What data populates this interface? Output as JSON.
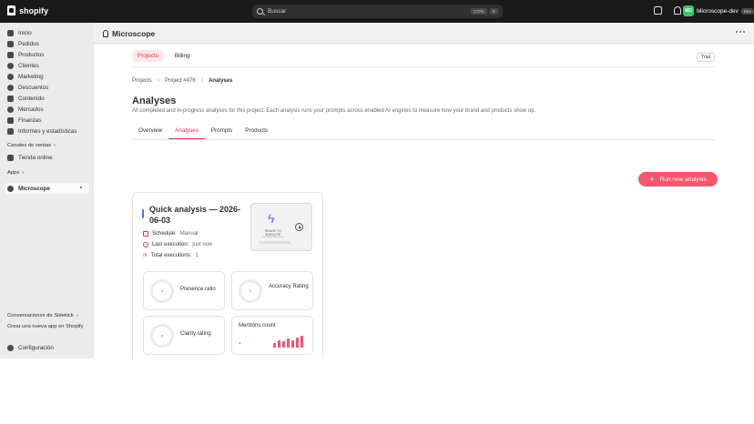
{
  "topbar": {
    "brand": "shopify",
    "search_placeholder": "Buscar",
    "shortcut_1": "CTRL",
    "shortcut_2": "K",
    "store_initials": "MD",
    "store_name": "Microscope-dev",
    "store_badge": "Dev"
  },
  "sidebar": {
    "items": [
      {
        "label": "Inicio",
        "icon": "home-icon"
      },
      {
        "label": "Pedidos",
        "icon": "orders-icon"
      },
      {
        "label": "Productos",
        "icon": "tag-icon"
      },
      {
        "label": "Clientes",
        "icon": "person-icon"
      },
      {
        "label": "Marketing",
        "icon": "target-icon"
      },
      {
        "label": "Descuentos",
        "icon": "discount-icon"
      },
      {
        "label": "Contenido",
        "icon": "content-icon"
      },
      {
        "label": "Mercados",
        "icon": "globe-icon"
      },
      {
        "label": "Finanzas",
        "icon": "bank-icon"
      },
      {
        "label": "Informes y estadísticas",
        "icon": "chart-icon"
      }
    ],
    "sales_channels_label": "Canales de ventas",
    "online_store_label": "Tienda online",
    "apps_label": "Apps",
    "app_item_label": "Microscope",
    "sidekick_label": "Conversaciones de Sidekick",
    "create_app_label": "Crear una nueva app en Shopify",
    "settings_label": "Configuración"
  },
  "app": {
    "title": "Microscope",
    "subnav": [
      "Projects",
      "Billing"
    ],
    "trial_badge": "Trial",
    "breadcrumb": [
      "Projects",
      "Project #476",
      "Analyses"
    ],
    "page_title": "Analyses",
    "page_desc": "All completed and in-progress analyses for this project. Each analysis runs your prompts across enabled AI engines to measure how your brand and products show up.",
    "tabs": [
      "Overview",
      "Analyses",
      "Prompts",
      "Products"
    ],
    "run_button": "Run new analysis"
  },
  "card": {
    "title": "Quick analysis — 2026-06-03",
    "schedule_label": "Schedule:",
    "schedule_value": "Manual",
    "last_exec_label": "Last execution:",
    "last_exec_value": "just now",
    "total_exec_label": "Total executions:",
    "total_exec_value": "1",
    "ready_title": "READY TO EXECUTE",
    "ready_sub": "No executions yet",
    "metrics": {
      "presence_label": "Presence ratio",
      "presence_value": "-",
      "accuracy_label": "Accuracy Rating",
      "accuracy_value": "-",
      "clarity_label": "Clarity rating",
      "clarity_value": "-",
      "mentions_label": "Mentions count",
      "mentions_value": "-"
    }
  },
  "colors": {
    "accent": "#f4566e",
    "accent_text": "#e5304e",
    "indicator": "#4f6be6"
  }
}
